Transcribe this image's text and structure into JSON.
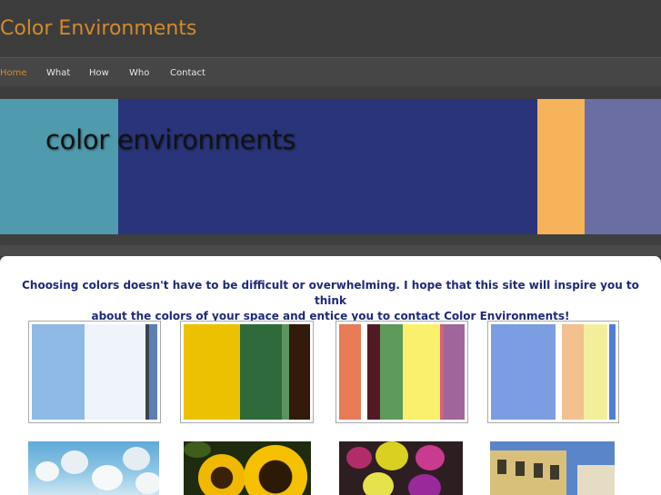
{
  "header": {
    "title": "Color Environments"
  },
  "nav": {
    "items": [
      {
        "label": "Home",
        "active": true
      },
      {
        "label": "What",
        "active": false
      },
      {
        "label": "How",
        "active": false
      },
      {
        "label": "Who",
        "active": false
      },
      {
        "label": "Contact",
        "active": false
      }
    ]
  },
  "banner": {
    "text": "color environments",
    "colors": [
      "#4f9aad",
      "#29347a",
      "#f6b35a",
      "#6a6ea2"
    ]
  },
  "main": {
    "intro_line1": "Choosing colors doesn't have to be difficult or overwhelming.  I hope that this site will inspire you to think",
    "intro_line2": "about the colors of your space and entice you to contact Color Environments!"
  },
  "palettes": [
    [
      "#8fb9e7",
      "#eef4fa",
      "#3c4250",
      "#5b7fb1"
    ],
    [
      "#ecc200",
      "#2e6a3a",
      "#5e9360",
      "#331a0a"
    ],
    [
      "#e77c56",
      "#521b24",
      "#5e9a5c",
      "#fbf06b",
      "#d2627a",
      "#a0659a"
    ],
    [
      "#7b9de1",
      "#f3c090",
      "#f3ee9c",
      "#4f7fd1"
    ]
  ],
  "photos": [
    "blossom-tree-photo",
    "sunflowers-photo",
    "dahlias-photo",
    "building-facade-photo"
  ]
}
